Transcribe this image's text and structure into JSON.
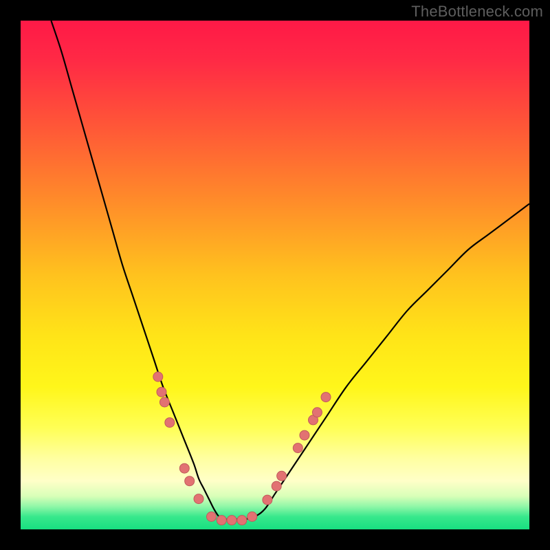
{
  "watermark": "TheBottleneck.com",
  "gradient_stops": [
    {
      "offset": 0.0,
      "color": "#ff1947"
    },
    {
      "offset": 0.08,
      "color": "#ff2a45"
    },
    {
      "offset": 0.2,
      "color": "#ff5438"
    },
    {
      "offset": 0.35,
      "color": "#ff8a2a"
    },
    {
      "offset": 0.5,
      "color": "#ffc21e"
    },
    {
      "offset": 0.62,
      "color": "#ffe418"
    },
    {
      "offset": 0.72,
      "color": "#fff61a"
    },
    {
      "offset": 0.8,
      "color": "#ffff55"
    },
    {
      "offset": 0.86,
      "color": "#ffffa0"
    },
    {
      "offset": 0.905,
      "color": "#ffffc8"
    },
    {
      "offset": 0.935,
      "color": "#d8ffb8"
    },
    {
      "offset": 0.955,
      "color": "#90f7a8"
    },
    {
      "offset": 0.975,
      "color": "#38e88c"
    },
    {
      "offset": 1.0,
      "color": "#18df80"
    }
  ],
  "chart_data": {
    "type": "line",
    "title": "",
    "xlabel": "",
    "ylabel": "",
    "xlim": [
      0,
      100
    ],
    "ylim": [
      0,
      100
    ],
    "series": [
      {
        "name": "bottleneck-curve",
        "x": [
          6,
          8,
          10,
          12,
          14,
          16,
          18,
          20,
          22,
          24,
          26,
          28,
          30,
          32,
          34,
          35,
          36,
          37,
          38,
          39,
          40,
          42,
          44,
          46,
          48,
          50,
          52,
          56,
          60,
          64,
          68,
          72,
          76,
          80,
          84,
          88,
          92,
          96,
          100
        ],
        "y": [
          100,
          94,
          87,
          80,
          73,
          66,
          59,
          52,
          46,
          40,
          34,
          28,
          23,
          18,
          13,
          10,
          8,
          6,
          4,
          2.5,
          2,
          2,
          2,
          2.5,
          4,
          7,
          10,
          16,
          22,
          28,
          33,
          38,
          43,
          47,
          51,
          55,
          58,
          61,
          64
        ]
      }
    ],
    "markers": [
      {
        "x": 27.0,
        "y": 30
      },
      {
        "x": 27.7,
        "y": 27
      },
      {
        "x": 28.3,
        "y": 25
      },
      {
        "x": 29.3,
        "y": 21
      },
      {
        "x": 32.2,
        "y": 12
      },
      {
        "x": 33.2,
        "y": 9.5
      },
      {
        "x": 35.0,
        "y": 6.0
      },
      {
        "x": 37.5,
        "y": 2.5
      },
      {
        "x": 39.5,
        "y": 1.8
      },
      {
        "x": 41.5,
        "y": 1.8
      },
      {
        "x": 43.5,
        "y": 1.8
      },
      {
        "x": 45.5,
        "y": 2.5
      },
      {
        "x": 48.5,
        "y": 5.8
      },
      {
        "x": 50.3,
        "y": 8.5
      },
      {
        "x": 51.3,
        "y": 10.5
      },
      {
        "x": 54.5,
        "y": 16.0
      },
      {
        "x": 55.8,
        "y": 18.5
      },
      {
        "x": 57.5,
        "y": 21.5
      },
      {
        "x": 58.3,
        "y": 23.0
      },
      {
        "x": 60.0,
        "y": 26.0
      }
    ],
    "marker_radius": 7
  }
}
